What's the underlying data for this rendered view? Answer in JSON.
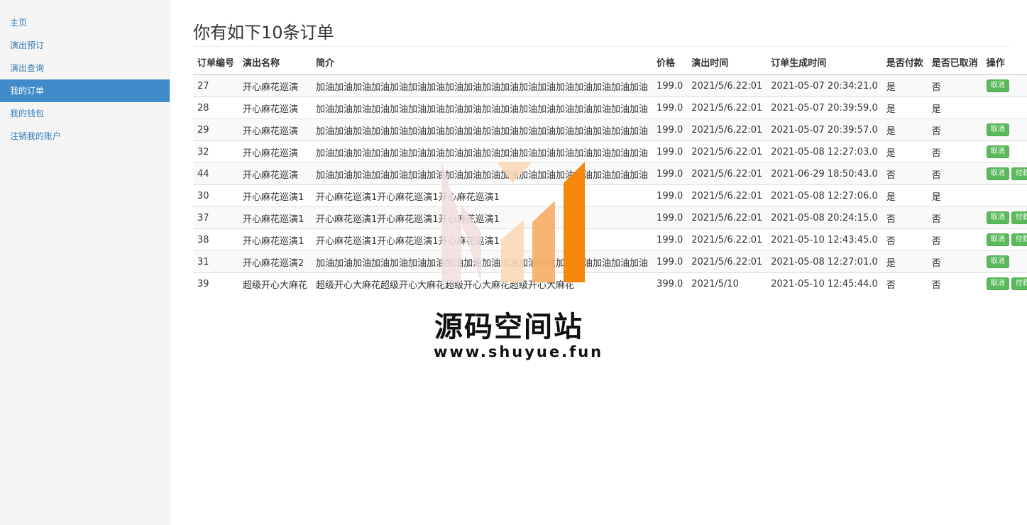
{
  "sidebar": {
    "items": [
      {
        "label": "主页",
        "active": false
      },
      {
        "label": "演出预订",
        "active": false
      },
      {
        "label": "演出查询",
        "active": false
      },
      {
        "label": "我的订单",
        "active": true
      },
      {
        "label": "我的钱包",
        "active": false
      },
      {
        "label": "注销我的账户",
        "active": false
      }
    ]
  },
  "main": {
    "title": "你有如下10条订单",
    "columns": [
      "订单编号",
      "演出名称",
      "简介",
      "价格",
      "演出时间",
      "订单生成时间",
      "是否付款",
      "是否已取消",
      "操作"
    ],
    "button_labels": {
      "cancel": "取消",
      "pay": "付款"
    },
    "rows": [
      {
        "id": "27",
        "name": "开心麻花巡演",
        "desc": "加油加油加油加油加油加油加油加油加油加油加油加油加油加油加油加油加油加油",
        "price": "199.0",
        "show_time": "2021/5/6.22:01",
        "created": "2021-05-07 20:34:21.0",
        "paid": "是",
        "cancelled": "否",
        "actions": [
          "cancel"
        ]
      },
      {
        "id": "28",
        "name": "开心麻花巡演",
        "desc": "加油加油加油加油加油加油加油加油加油加油加油加油加油加油加油加油加油加油",
        "price": "199.0",
        "show_time": "2021/5/6.22:01",
        "created": "2021-05-07 20:39:59.0",
        "paid": "是",
        "cancelled": "是",
        "actions": []
      },
      {
        "id": "29",
        "name": "开心麻花巡演",
        "desc": "加油加油加油加油加油加油加油加油加油加油加油加油加油加油加油加油加油加油",
        "price": "199.0",
        "show_time": "2021/5/6.22:01",
        "created": "2021-05-07 20:39:57.0",
        "paid": "是",
        "cancelled": "否",
        "actions": [
          "cancel"
        ]
      },
      {
        "id": "32",
        "name": "开心麻花巡演",
        "desc": "加油加油加油加油加油加油加油加油加油加油加油加油加油加油加油加油加油加油",
        "price": "199.0",
        "show_time": "2021/5/6.22:01",
        "created": "2021-05-08 12:27:03.0",
        "paid": "是",
        "cancelled": "否",
        "actions": [
          "cancel"
        ]
      },
      {
        "id": "44",
        "name": "开心麻花巡演",
        "desc": "加油加油加油加油加油加油加油加油加油加油加油加油加油加油加油加油加油加油",
        "price": "199.0",
        "show_time": "2021/5/6.22:01",
        "created": "2021-06-29 18:50:43.0",
        "paid": "否",
        "cancelled": "否",
        "actions": [
          "cancel",
          "pay"
        ]
      },
      {
        "id": "30",
        "name": "开心麻花巡演1",
        "desc": "开心麻花巡演1开心麻花巡演1开心麻花巡演1",
        "price": "199.0",
        "show_time": "2021/5/6.22:01",
        "created": "2021-05-08 12:27:06.0",
        "paid": "是",
        "cancelled": "是",
        "actions": []
      },
      {
        "id": "37",
        "name": "开心麻花巡演1",
        "desc": "开心麻花巡演1开心麻花巡演1开心麻花巡演1",
        "price": "199.0",
        "show_time": "2021/5/6.22:01",
        "created": "2021-05-08 20:24:15.0",
        "paid": "否",
        "cancelled": "否",
        "actions": [
          "cancel",
          "pay"
        ]
      },
      {
        "id": "38",
        "name": "开心麻花巡演1",
        "desc": "开心麻花巡演1开心麻花巡演1开心麻花巡演1",
        "price": "199.0",
        "show_time": "2021/5/6.22:01",
        "created": "2021-05-10 12:43:45.0",
        "paid": "否",
        "cancelled": "否",
        "actions": [
          "cancel",
          "pay"
        ]
      },
      {
        "id": "31",
        "name": "开心麻花巡演2",
        "desc": "加油加油加油加油加油加油加油加油加油加油加油加油加油加油加油加油加油加油",
        "price": "199.0",
        "show_time": "2021/5/6.22:01",
        "created": "2021-05-08 12:27:01.0",
        "paid": "是",
        "cancelled": "否",
        "actions": [
          "cancel"
        ]
      },
      {
        "id": "39",
        "name": "超级开心大麻花",
        "desc": "超级开心大麻花超级开心大麻花超级开心大麻花超级开心大麻花",
        "price": "399.0",
        "show_time": "2021/5/10",
        "created": "2021-05-10 12:45:44.0",
        "paid": "否",
        "cancelled": "否",
        "actions": [
          "cancel",
          "pay"
        ]
      }
    ]
  },
  "watermark": {
    "title": "源码空间站",
    "url": "www.shuyue.fun",
    "colors": {
      "orange": "#f5870a",
      "light_orange": "#f7b06a",
      "pink": "#f2dede",
      "peach": "#f9d9b8"
    }
  }
}
